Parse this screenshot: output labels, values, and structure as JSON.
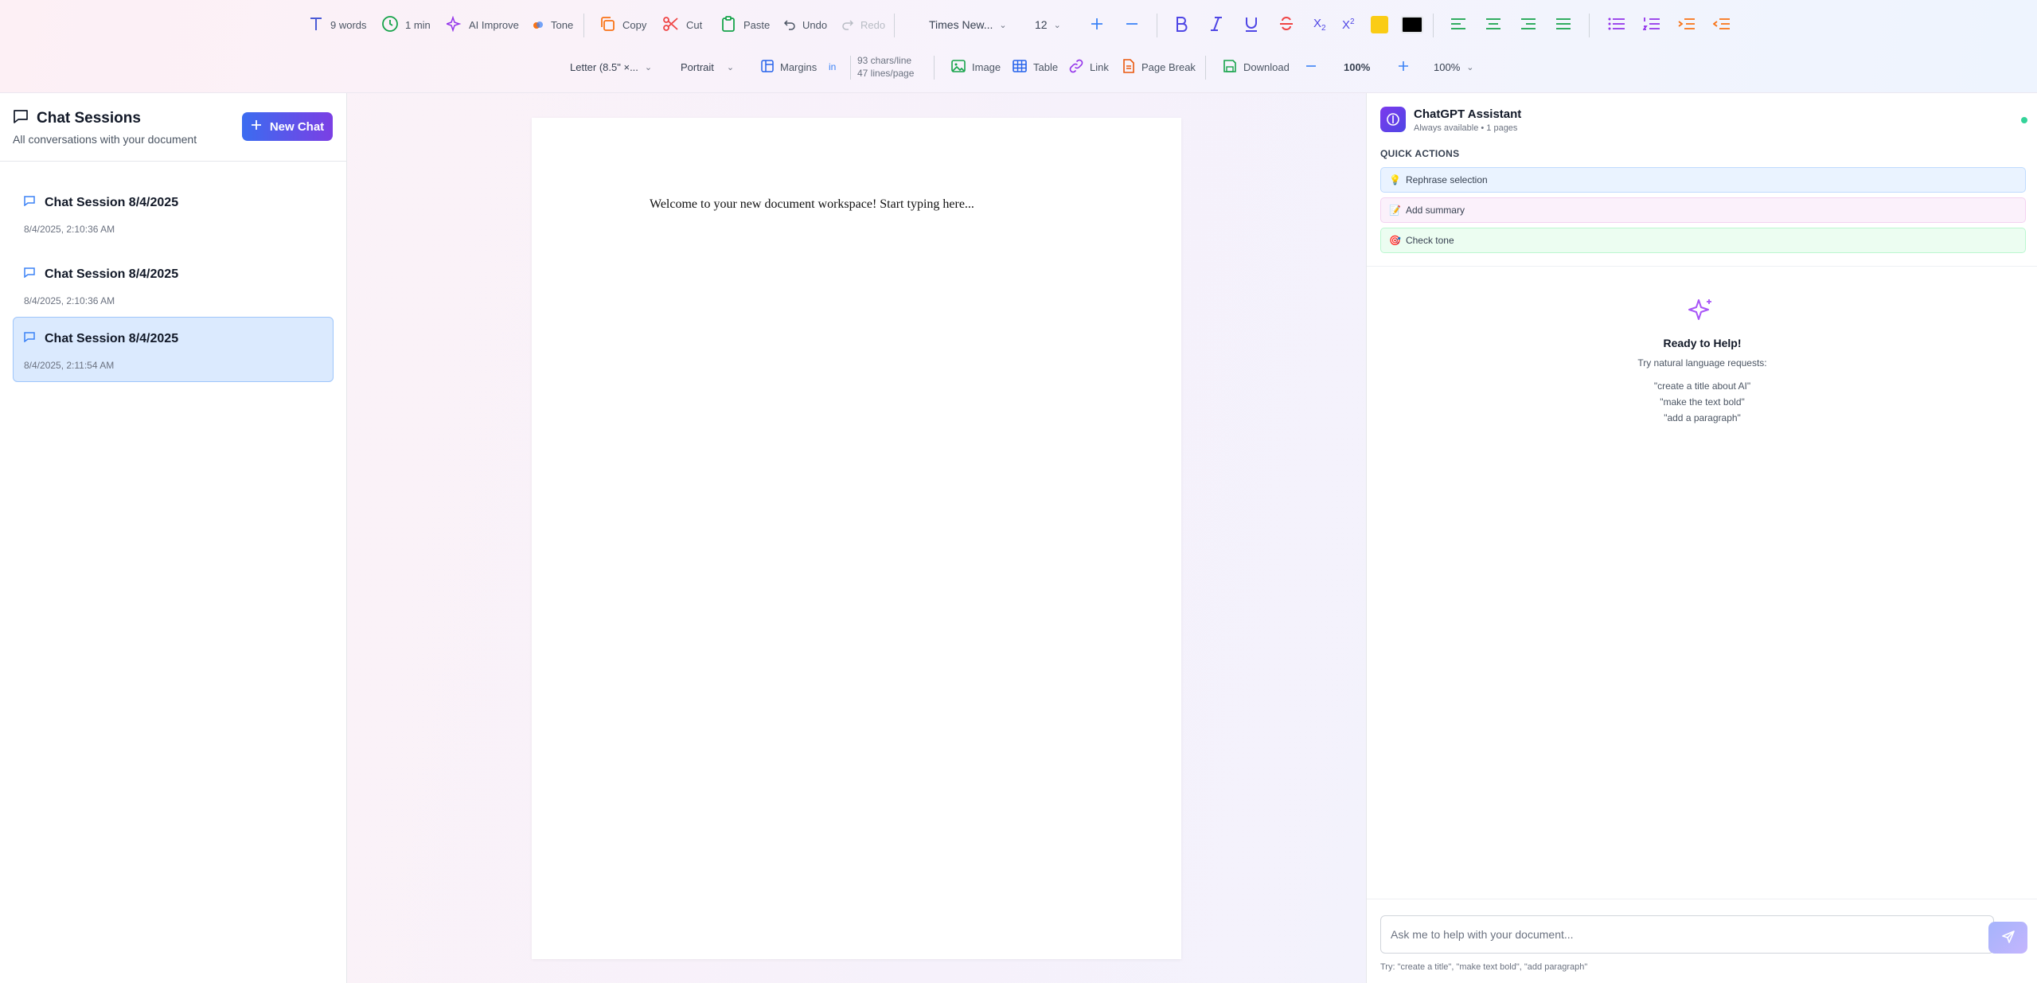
{
  "toolbar": {
    "word_count": "9 words",
    "read_time": "1 min",
    "ai_improve": "AI Improve",
    "tone": "Tone",
    "copy": "Copy",
    "cut": "Cut",
    "paste": "Paste",
    "undo": "Undo",
    "redo": "Redo",
    "font_family": "Times New...",
    "font_size": "12",
    "highlight_color": "#facc15",
    "text_color": "#000000",
    "page_size": "Letter (8.5\" ×...",
    "orientation": "Portrait",
    "margins": "Margins",
    "unit": "in",
    "chars_per_line": "93 chars/line",
    "lines_per_page": "47 lines/page",
    "image": "Image",
    "table": "Table",
    "link": "Link",
    "page_break": "Page Break",
    "download": "Download",
    "zoom_value": "100%",
    "zoom_select": "100%"
  },
  "sidebar": {
    "title": "Chat Sessions",
    "subtitle": "All conversations with your document",
    "new_chat": "New Chat",
    "sessions": [
      {
        "title": "Chat Session 8/4/2025",
        "time": "8/4/2025, 2:10:36 AM"
      },
      {
        "title": "Chat Session 8/4/2025",
        "time": "8/4/2025, 2:10:36 AM"
      },
      {
        "title": "Chat Session 8/4/2025",
        "time": "8/4/2025, 2:11:54 AM"
      }
    ]
  },
  "document": {
    "text": "Welcome to your new document workspace! Start typing here..."
  },
  "assistant": {
    "name": "ChatGPT Assistant",
    "status": "Always available • 1 pages",
    "quick_actions_title": "QUICK ACTIONS",
    "quick_actions": [
      "Rephrase selection",
      "Add summary",
      "Check tone"
    ],
    "quick_action_icons": [
      "💡",
      "📝",
      "🎯"
    ],
    "ready_title": "Ready to Help!",
    "ready_subtitle": "Try natural language requests:",
    "examples": [
      "\"create a title about AI\"",
      "\"make the text bold\"",
      "\"add a paragraph\""
    ],
    "input_placeholder": "Ask me to help with your document...",
    "hint": "Try: \"create a title\", \"make text bold\", \"add paragraph\""
  }
}
